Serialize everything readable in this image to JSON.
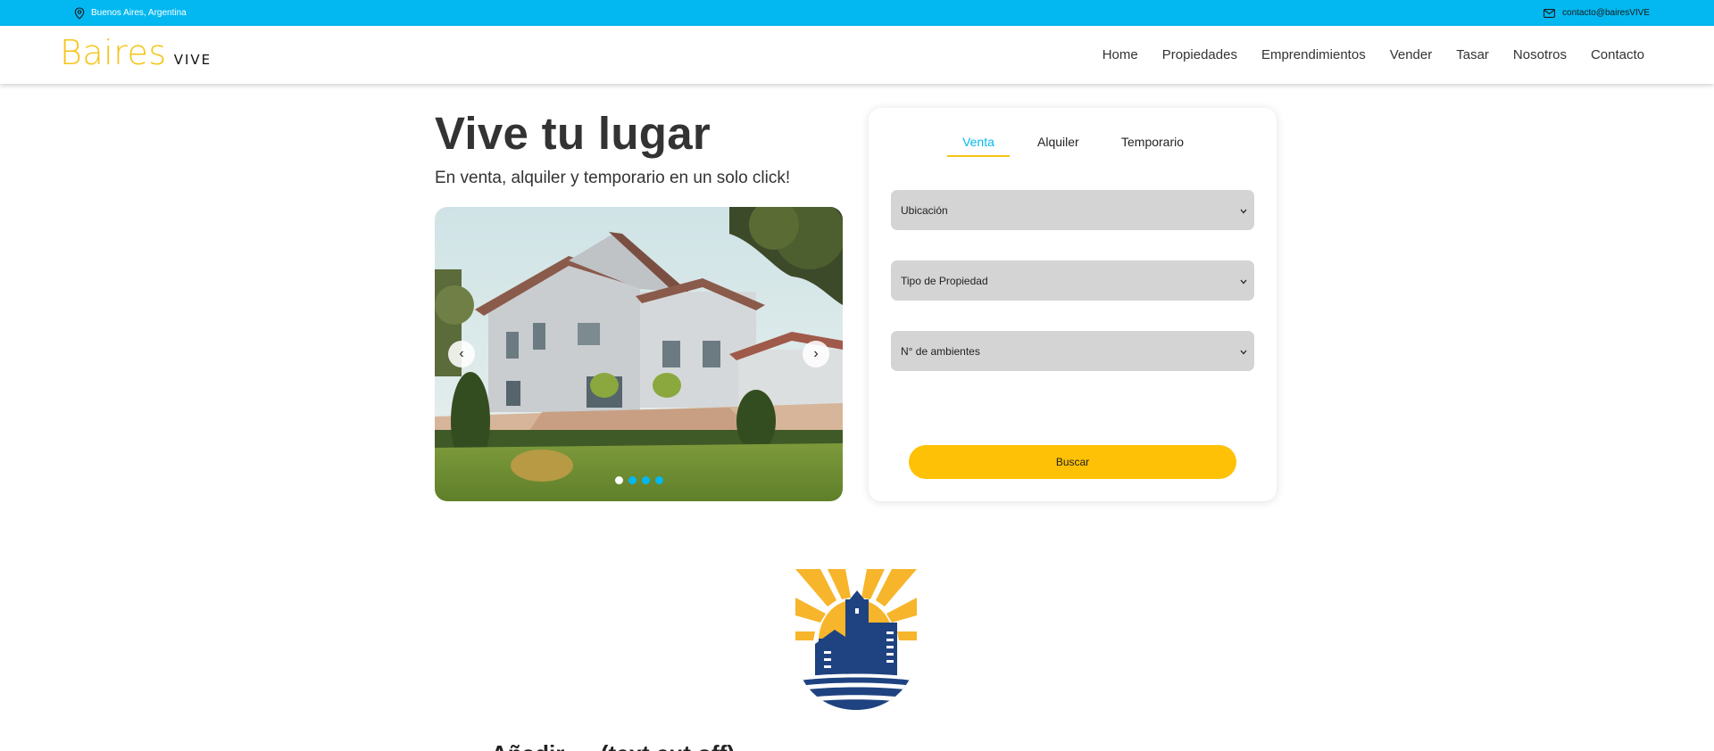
{
  "topbar": {
    "location": "Buenos Aires, Argentina",
    "location_icon": "map-pin-icon",
    "email": "contacto@bairesVIVE",
    "email_icon": "mail-icon",
    "background_color": "#03b8f0"
  },
  "brand": {
    "name_part1": "Baires",
    "name_part2": "VIVE",
    "accent_color": "#f6c419"
  },
  "nav": {
    "items": [
      "Home",
      "Propiedades",
      "Emprendimientos",
      "Vender",
      "Tasar",
      "Nosotros",
      "Contacto"
    ]
  },
  "hero": {
    "title": "Vive tu lugar",
    "subtitle": "En venta, alquiler y temporario en un solo click!"
  },
  "carousel": {
    "prev_label": "‹",
    "next_label": "›",
    "slide_count": 4,
    "active_slide": 1
  },
  "search": {
    "tabs": [
      "Venta",
      "Alquiler",
      "Temporario"
    ],
    "active_tab": "Venta",
    "selects": [
      {
        "value": "Ubicación"
      },
      {
        "value": "Tipo de Propiedad"
      },
      {
        "value": "N° de ambientes"
      }
    ],
    "button_label": "Buscar",
    "button_color": "#ffc105"
  },
  "section": {
    "heading_partial": "Añadir … (text cut off)"
  }
}
